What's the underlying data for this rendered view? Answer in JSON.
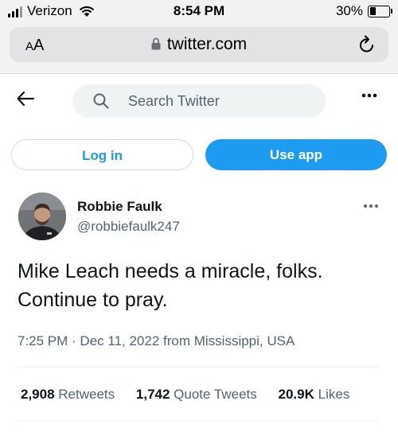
{
  "status_bar": {
    "carrier": "Verizon",
    "time": "8:54 PM",
    "battery_percent": "30%",
    "battery_level": 0.3,
    "icons": [
      "signal-icon",
      "wifi-icon",
      "battery-icon"
    ]
  },
  "browser": {
    "text_size_label_big": "A",
    "text_size_label_small": "A",
    "url": "twitter.com",
    "icons": [
      "lock-icon",
      "reload-icon"
    ]
  },
  "nav": {
    "search_placeholder": "Search Twitter",
    "icons": [
      "back-arrow-icon",
      "search-icon",
      "more-icon"
    ]
  },
  "buttons": {
    "login": "Log in",
    "use_app": "Use app"
  },
  "tweet": {
    "author_name": "Robbie Faulk",
    "author_handle": "@robbiefaulk247",
    "text": "Mike Leach needs a miracle, folks. Continue to pray.",
    "timestamp": "7:25 PM · Dec 11, 2022 from Mississippi, USA",
    "stats": {
      "retweets_count": "2,908",
      "retweets_label": "Retweets",
      "quotes_count": "1,742",
      "quotes_label": "Quote Tweets",
      "likes_count": "20.9K",
      "likes_label": "Likes"
    }
  },
  "colors": {
    "accent": "#1d9bf0",
    "text_primary": "#0f1419",
    "text_secondary": "#536471",
    "search_bg": "#eff3f4"
  }
}
